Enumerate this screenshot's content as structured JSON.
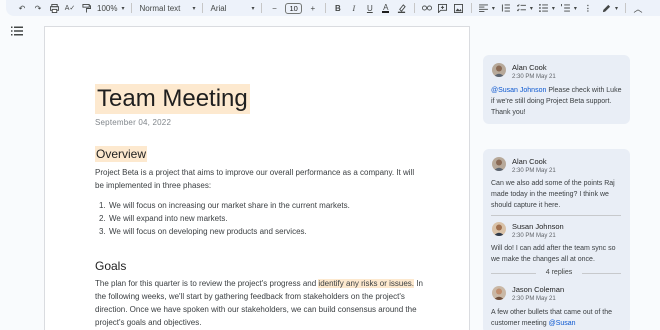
{
  "toolbar": {
    "zoom": "100%",
    "style": "Normal text",
    "font": "Arial",
    "font_size": "10",
    "minus": "−",
    "plus": "+"
  },
  "document": {
    "title": "Team Meeting",
    "date": "September 04, 2022",
    "overview_heading": "Overview",
    "overview_text": "Project Beta is a project that aims to improve our overall performance as a company. It will be implemented in three phases:",
    "phases": [
      {
        "num": "1.",
        "text": "We will focus on increasing our market share in the current markets."
      },
      {
        "num": "2.",
        "text": "We will expand into new markets."
      },
      {
        "num": "3.",
        "text": "We will focus on developing new products and services."
      }
    ],
    "goals_heading": "Goals",
    "goals_text_before": "The plan for this quarter is to review the project's progress and ",
    "goals_highlight": "identify any risks or issues.",
    "goals_text_after": " In the following weeks, we'll start by gathering feedback from stakeholders on the project's direction. Once we have spoken with our stakeholders, we can build consensus around the project's goals and objectives."
  },
  "comments": {
    "thread1": {
      "author": "Alan Cook",
      "time": "2:30 PM May 21",
      "mention": "@Susan Johnson",
      "text": " Please check with Luke if we're still doing Project Beta support. Thank you!"
    },
    "thread2": {
      "author": "Alan Cook",
      "time": "2:30 PM May 21",
      "text": "Can we also add some of the points Raj made today in the meeting? I think we should capture it here.",
      "reply1_author": "Susan Johnson",
      "reply1_time": "2:30 PM May 21",
      "reply1_text": "Will do! I can add after the team sync so we make the changes all at once.",
      "replies_count": "4 replies",
      "reply2_author": "Jason Coleman",
      "reply2_time": "2:30 PM May 21",
      "reply2_text": "A few other bullets that came out of the customer meeting ",
      "reply2_mention": "@Susan"
    }
  },
  "colors": {
    "highlight": "#fde9cf",
    "mention": "#0b57d0",
    "comment_card": "#e9eef6",
    "toolbar": "#edf2fa"
  }
}
